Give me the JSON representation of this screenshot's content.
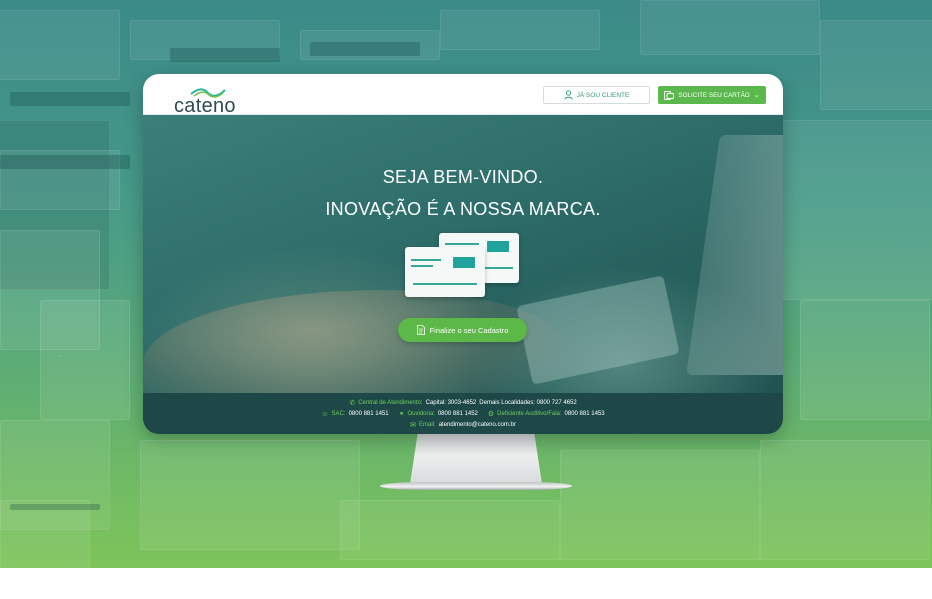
{
  "brand": {
    "name": "cateno"
  },
  "header": {
    "client_button": "JÁ SOU CLIENTE",
    "card_button": "SOLICITE SEU CARTÃO",
    "colors": {
      "accent_green": "#5ab84c",
      "teal": "#2f9a7e"
    }
  },
  "hero": {
    "title_line1": "SEJA BEM-VINDO.",
    "title_line2": "INOVAÇÃO É A NOSSA MARCA.",
    "cta_label": "Finalize o seu Cadastro"
  },
  "footer": {
    "central_label": "Central de Atendimento:",
    "capital": "Capital: 3003-4652",
    "demais": "Demais Localidades: 0800 727 4652",
    "sac_label": "SAC:",
    "sac_value": "0800 881 1451",
    "ouvidoria_label": "Ouvidoria:",
    "ouvidoria_value": "0800 881 1452",
    "deficiente_label": "Deficiente Auditivo/Fala:",
    "deficiente_value": "0800 881 1453",
    "email_label": "Email:",
    "email_value": "atendimento@cateno.com.br"
  },
  "icons": [
    "user-icon",
    "card-icon",
    "chevron-down-icon",
    "document-icon",
    "phone-icon",
    "sac-icon",
    "headset-icon",
    "hearing-icon",
    "mail-icon"
  ]
}
